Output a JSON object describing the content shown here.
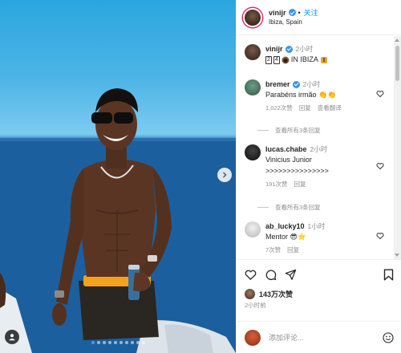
{
  "post": {
    "username": "vinijr",
    "follow_label": "关注",
    "location": "Ibiza, Spain",
    "caption_time": "2小时",
    "caption": "2️⃣4️⃣ 🦁 IN IBIZA 🏝",
    "caption_parts": {
      "num1": "2",
      "num2": "4",
      "suffix": "IN IBIZA"
    }
  },
  "comments": [
    {
      "username": "bremer",
      "verified": true,
      "time": "2小时",
      "text": "Parabéns irmão 👏👏",
      "likes": "1,022次赞",
      "reply": "回复",
      "translate": "查看翻译",
      "more": "查看所有3条回复",
      "avatar_color": "#4c7a66"
    },
    {
      "username": "lucas.chabe",
      "verified": false,
      "time": "2小时",
      "text": "Vinicius Junior",
      "text2": ">>>>>>>>>>>>>>>",
      "likes": "191次赞",
      "reply": "回复",
      "more": "查看所有3条回复",
      "avatar_color": "#1c1c1c"
    },
    {
      "username": "ab_lucky10",
      "verified": false,
      "time": "1小时",
      "text": "Mentor 😎⭐",
      "likes": "7次赞",
      "reply": "回复",
      "avatar_color": "#d9d9d9"
    }
  ],
  "actions": {
    "likes_count": "143万次赞",
    "posted_ago": "2小时前",
    "comment_placeholder": "添加评论..."
  },
  "carousel": {
    "slide_count": 10,
    "active_index": 0
  },
  "colors": {
    "accent": "#0095f6",
    "verified": "#3897f0",
    "sea": "#1a5e9d",
    "sky": "#2aa6df",
    "shorts_band": "#f2a31b"
  }
}
